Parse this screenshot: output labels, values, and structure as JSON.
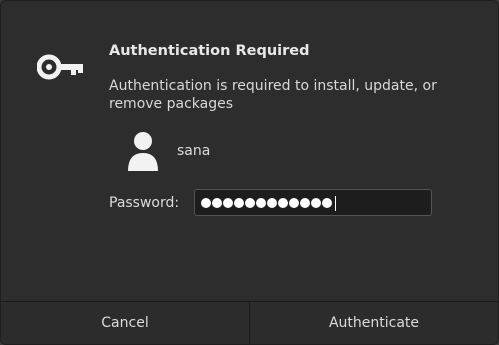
{
  "dialog": {
    "title": "Authentication Required",
    "description": "Authentication is required to install, update, or remove packages",
    "user": {
      "name": "sana"
    },
    "password": {
      "label": "Password:",
      "masked_length": 12
    },
    "buttons": {
      "cancel": "Cancel",
      "authenticate": "Authenticate"
    }
  },
  "icons": {
    "key": "key-icon",
    "user": "user-avatar-icon"
  },
  "colors": {
    "dialog_bg": "#2d2d2d",
    "text": "#e8e8e8",
    "input_bg": "#1d1d1d"
  }
}
